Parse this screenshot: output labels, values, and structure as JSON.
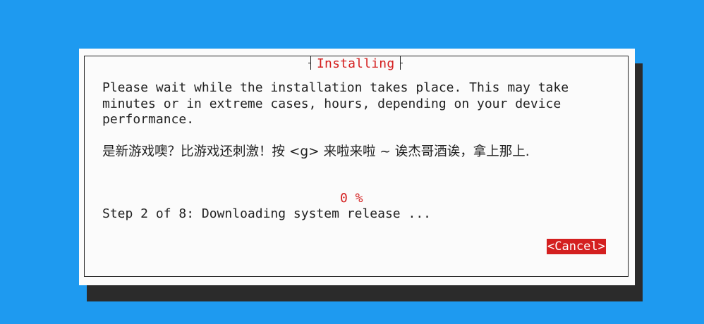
{
  "dialog": {
    "title": "Installing",
    "message": "Please wait while the installation takes place. This may take minutes or in extreme cases, hours, depending on your device performance.",
    "game_prompt": "是新游戏噢？比游戏还刺激！按 <g> 来啦来啦 ~ 诶杰哥酒诶，拿上那上.",
    "progress_percent": "0 %",
    "step_text": "Step 2 of 8: Downloading system release ...",
    "cancel_label": "<Cancel>"
  },
  "colors": {
    "background": "#1e9af0",
    "dialog": "#fbfbfb",
    "shadow": "#2b2b2b",
    "accent": "#d42020",
    "text": "#222222"
  }
}
